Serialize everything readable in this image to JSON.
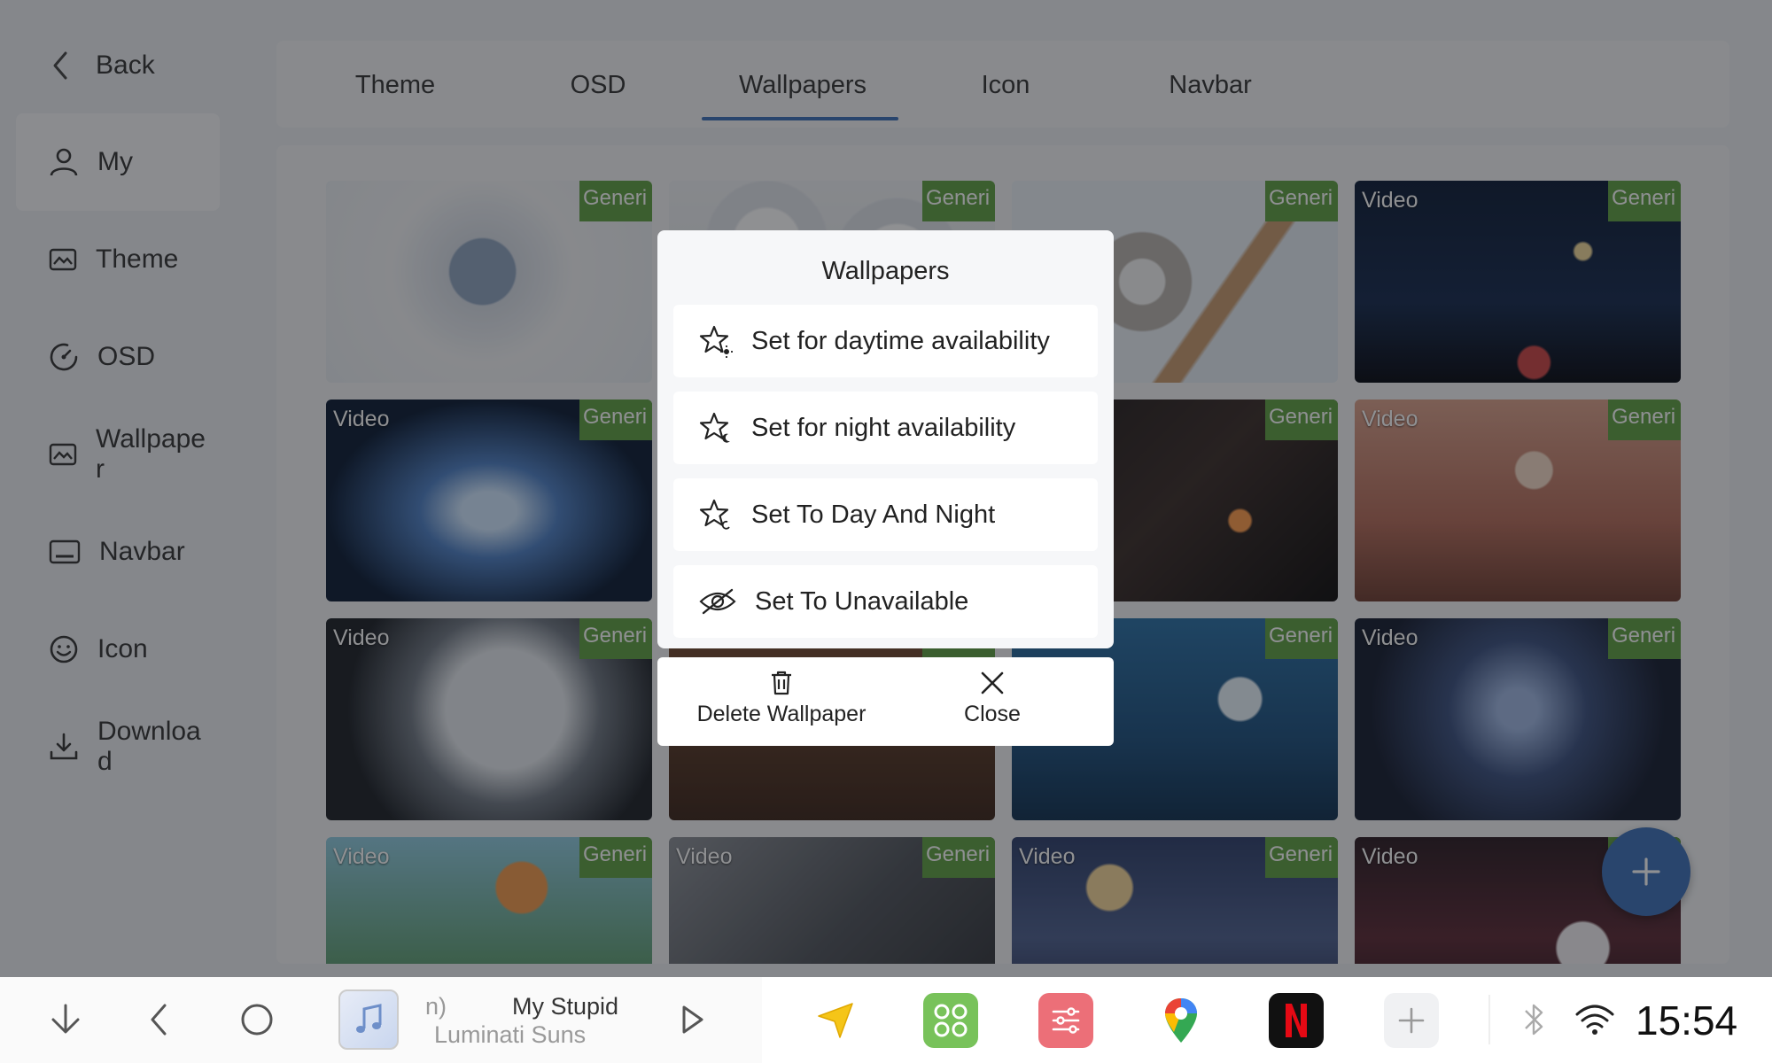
{
  "sidebar": {
    "back_label": "Back",
    "items": [
      {
        "label": "My",
        "icon": "user-icon",
        "active": true
      },
      {
        "label": "Theme",
        "icon": "image-icon"
      },
      {
        "label": "OSD",
        "icon": "gauge-icon"
      },
      {
        "label": "Wallpaper",
        "icon": "image-icon"
      },
      {
        "label": "Navbar",
        "icon": "navbar-icon"
      },
      {
        "label": "Icon",
        "icon": "smiley-icon"
      },
      {
        "label": "Downloa d",
        "icon": "download-icon"
      }
    ]
  },
  "tabs": [
    {
      "label": "Theme"
    },
    {
      "label": "OSD"
    },
    {
      "label": "Wallpapers",
      "active": true
    },
    {
      "label": "Icon"
    },
    {
      "label": "Navbar"
    }
  ],
  "grid": {
    "badge_label": "Generi",
    "video_label": "Video",
    "tiles": [
      {
        "video": false,
        "scene": "glass-sphere-sky"
      },
      {
        "video": false,
        "scene": "white-spheres"
      },
      {
        "video": false,
        "scene": "glass-orb-dandelion"
      },
      {
        "video": true,
        "scene": "night-car-moon"
      },
      {
        "video": true,
        "scene": "crystal-lotus"
      },
      {
        "video": false,
        "scene": "hidden"
      },
      {
        "video": false,
        "scene": "glass-cubes"
      },
      {
        "video": true,
        "scene": "sakura-pagoda"
      },
      {
        "video": true,
        "scene": "moon-willow-lake"
      },
      {
        "video": false,
        "scene": "portrait-warm"
      },
      {
        "video": false,
        "scene": "underwater-girl"
      },
      {
        "video": true,
        "scene": "dragon-warrior"
      },
      {
        "video": true,
        "scene": "van-umbrella"
      },
      {
        "video": true,
        "scene": "girl-umbrella-rain"
      },
      {
        "video": true,
        "scene": "girl-moon-night"
      },
      {
        "video": true,
        "scene": "city-girl-neon"
      }
    ]
  },
  "fab": {
    "icon": "plus-icon"
  },
  "dialog": {
    "title": "Wallpapers",
    "options": [
      {
        "label": "Set for daytime availability",
        "icon": "star-sun-icon"
      },
      {
        "label": "Set for night availability",
        "icon": "star-moon-icon"
      },
      {
        "label": "Set To Day And Night",
        "icon": "star-icon"
      },
      {
        "label": "Set To Unavailable",
        "icon": "eye-off-icon"
      }
    ],
    "delete_label": "Delete Wallpaper",
    "close_label": "Close"
  },
  "taskbar": {
    "track_title": "My Stupid",
    "track_artist": "Luminati Suns",
    "track_fragment": "n)",
    "clock": "15:54",
    "colors": {
      "accent": "#3d6fb8",
      "badge": "#5fa041"
    }
  }
}
